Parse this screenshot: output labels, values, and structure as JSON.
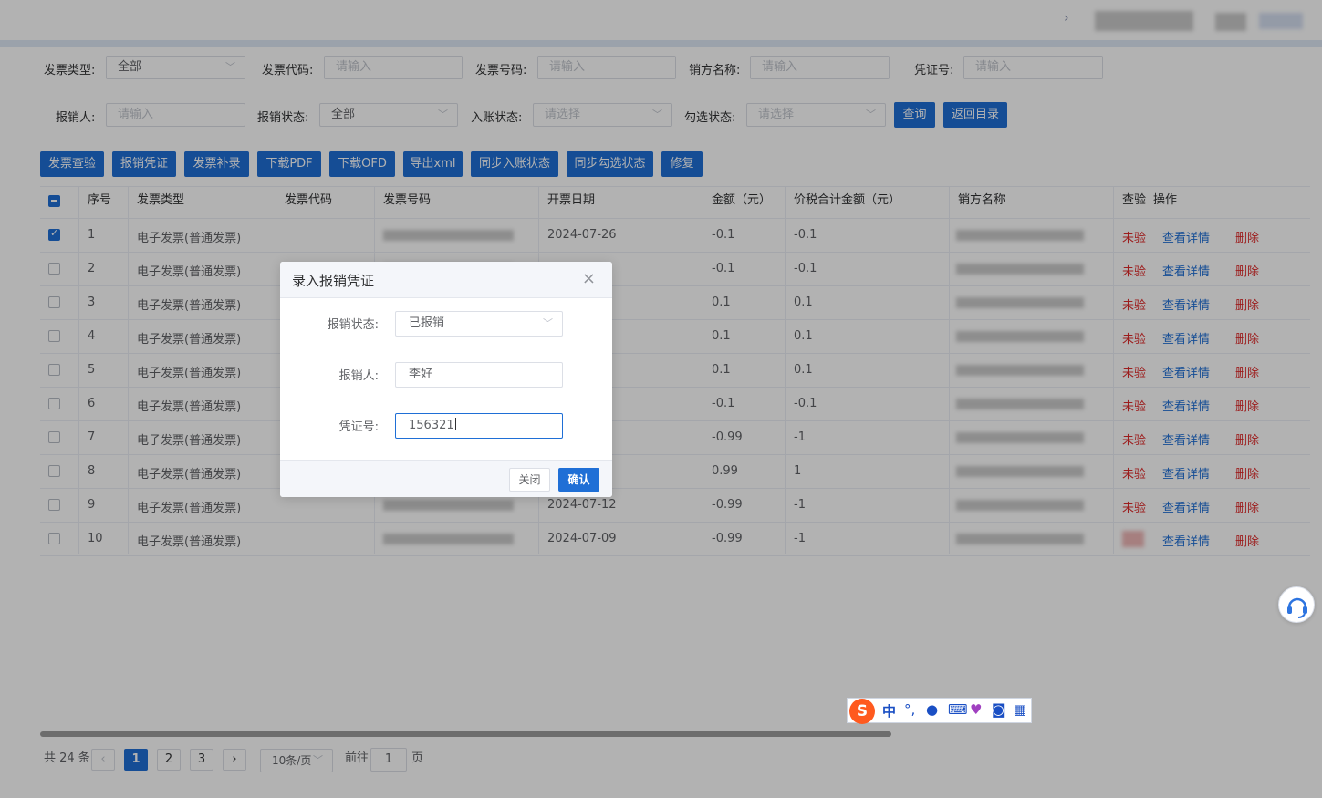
{
  "filters": {
    "invoice_type": {
      "label": "发票类型:",
      "value": "全部"
    },
    "invoice_code": {
      "label": "发票代码:",
      "placeholder": "请输入"
    },
    "invoice_no": {
      "label": "发票号码:",
      "placeholder": "请输入"
    },
    "seller_name": {
      "label": "销方名称:",
      "placeholder": "请输入"
    },
    "voucher_no": {
      "label": "凭证号:",
      "placeholder": "请输入"
    },
    "reimburser": {
      "label": "报销人:",
      "placeholder": "请输入"
    },
    "reimb_status": {
      "label": "报销状态:",
      "value": "全部"
    },
    "entry_status": {
      "label": "入账状态:",
      "placeholder": "请选择"
    },
    "check_status": {
      "label": "勾选状态:",
      "placeholder": "请选择"
    },
    "query_btn": "查询",
    "back_btn": "返回目录"
  },
  "toolbar": [
    "发票查验",
    "报销凭证",
    "发票补录",
    "下载PDF",
    "下载OFD",
    "导出xml",
    "同步入账状态",
    "同步勾选状态",
    "修复"
  ],
  "table": {
    "headers": {
      "seq": "序号",
      "type": "发票类型",
      "code": "发票代码",
      "number": "发票号码",
      "date": "开票日期",
      "amount": "金额（元）",
      "total": "价税合计金额（元）",
      "seller": "销方名称",
      "check": "查验",
      "ops": "操作"
    },
    "rows": [
      {
        "seq": "1",
        "type": "电子发票(普通发票)",
        "date": "2024-07-26",
        "amount": "-0.1",
        "total": "-0.1",
        "check": "未验",
        "checked": true
      },
      {
        "seq": "2",
        "type": "电子发票(普通发票)",
        "date": "",
        "amount": "-0.1",
        "total": "-0.1",
        "check": "未验",
        "checked": false
      },
      {
        "seq": "3",
        "type": "电子发票(普通发票)",
        "date": "",
        "amount": "0.1",
        "total": "0.1",
        "check": "未验",
        "checked": false
      },
      {
        "seq": "4",
        "type": "电子发票(普通发票)",
        "date": "",
        "amount": "0.1",
        "total": "0.1",
        "check": "未验",
        "checked": false
      },
      {
        "seq": "5",
        "type": "电子发票(普通发票)",
        "date": "",
        "amount": "0.1",
        "total": "0.1",
        "check": "未验",
        "checked": false
      },
      {
        "seq": "6",
        "type": "电子发票(普通发票)",
        "date": "",
        "amount": "-0.1",
        "total": "-0.1",
        "check": "未验",
        "checked": false
      },
      {
        "seq": "7",
        "type": "电子发票(普通发票)",
        "date": "",
        "amount": "-0.99",
        "total": "-1",
        "check": "未验",
        "checked": false
      },
      {
        "seq": "8",
        "type": "电子发票(普通发票)",
        "date": "",
        "amount": "0.99",
        "total": "1",
        "check": "未验",
        "checked": false
      },
      {
        "seq": "9",
        "type": "电子发票(普通发票)",
        "date": "2024-07-12",
        "amount": "-0.99",
        "total": "-1",
        "check": "未验",
        "checked": false
      },
      {
        "seq": "10",
        "type": "电子发票(普通发票)",
        "date": "2024-07-09",
        "amount": "-0.99",
        "total": "-1",
        "check": "",
        "checked": false
      }
    ],
    "view_label": "查看详情",
    "delete_label": "删除"
  },
  "pagination": {
    "total": "共 24 条",
    "pages": [
      "1",
      "2",
      "3"
    ],
    "current": "1",
    "page_size": "10条/页",
    "goto_label": "前往",
    "goto_value": "1",
    "page_suffix": "页"
  },
  "dialog": {
    "title": "录入报销凭证",
    "close_icon": "×",
    "status_label": "报销状态:",
    "status_value": "已报销",
    "person_label": "报销人:",
    "person_value": "李好",
    "voucher_label": "凭证号:",
    "voucher_value": "156321",
    "cancel": "关闭",
    "confirm": "确认"
  },
  "ime": {
    "lang": "中"
  },
  "colors": {
    "primary": "#1f6fd6",
    "danger": "#e02a2a",
    "mask": "rgba(0,0,0,0.30)"
  }
}
